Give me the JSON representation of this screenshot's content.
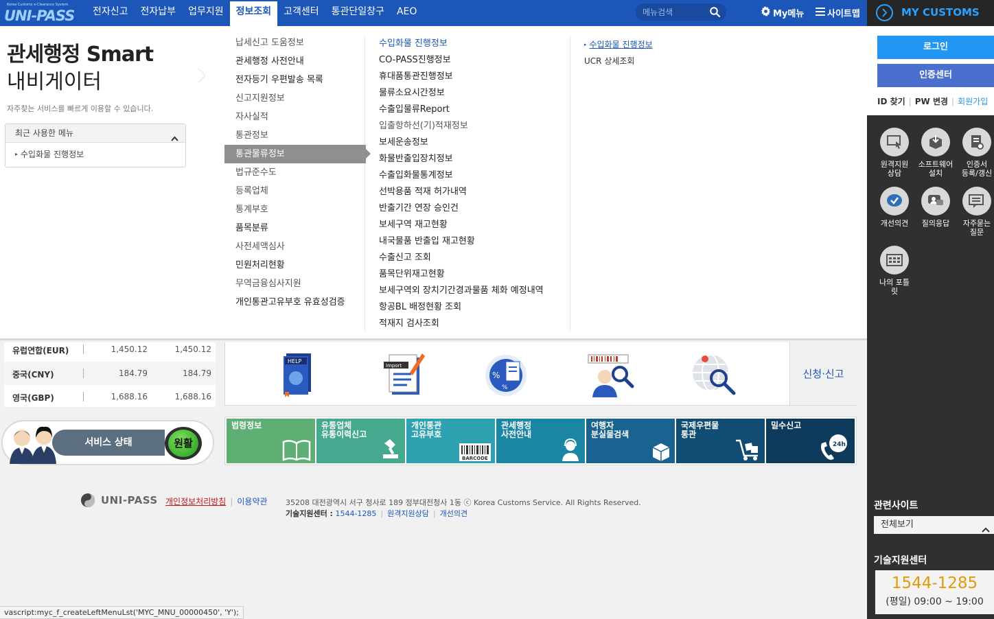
{
  "brand": {
    "tiny": "Korea Customs e-Clearance System",
    "name": "UNI-PASS"
  },
  "nav": {
    "items": [
      "전자신고",
      "전자납부",
      "업무지원",
      "정보조회",
      "고객센터",
      "통관단일창구",
      "AEO"
    ],
    "active": "정보조회"
  },
  "search": {
    "placeholder": "메뉴검색",
    "icon": "search-icon"
  },
  "top_links": {
    "my_menu": "My메뉴",
    "sitemap": "사이트맵"
  },
  "mega": {
    "title_line1": "관세행정 Smart",
    "title_line2": "내비게이터",
    "description": "자주찾는 서비스를 빠르게 이용할 수 있습니다.",
    "recent": {
      "header": "최근 사용한 메뉴",
      "items": [
        "수입화물 진행정보"
      ]
    },
    "col1": [
      "납세신고 도움정보",
      "관세행정 사전안내",
      "전자등기 우편발송 목록",
      "신고지원정보",
      "자사실적",
      "통관정보",
      "통관물류정보",
      "법규준수도",
      "등록업체",
      "통계부호",
      "품목분류",
      "사전세액심사",
      "민원처리현황",
      "무역금융심사지원",
      "개인통관고유부호 유효성검증"
    ],
    "col1_selected": "통관물류정보",
    "col2": [
      "수입화물 진행정보",
      "CO-PASS진행정보",
      "휴대품통관진행정보",
      "물류소요시간정보",
      "수출입물류Report",
      "입출항하선(기)적재정보",
      "보세운송정보",
      "화물반출입장치정보",
      "수출입화물통계정보",
      "선박용품 적재 허가내역",
      "반출기간 연장 승인건",
      "보세구역 재고현황",
      "내국물품 반출입 재고현황",
      "수출신고 조회",
      "품목단위재고현황",
      "보세구역외 장치기간경과물품 체화 예정내역",
      "항공BL 배정현황 조회",
      "적재지 검사조회"
    ],
    "col3": [
      "수입화물 진행정보",
      "UCR 상세조회"
    ]
  },
  "exchange": [
    {
      "currency": "유럽연합(EUR)",
      "buy": "1,450.12",
      "sell": "1,450.12"
    },
    {
      "currency": "중국(CNY)",
      "buy": "184.79",
      "sell": "184.79"
    },
    {
      "currency": "영국(GBP)",
      "buy": "1,688.16",
      "sell": "1,688.16"
    }
  ],
  "service": {
    "label": "서비스 상태",
    "status": "원활"
  },
  "icon_panel": {
    "icons": [
      "help-book-icon",
      "import-document-icon",
      "percent-document-icon",
      "barcode-search-icon",
      "globe-search-icon"
    ],
    "apply_label": "신청·신고"
  },
  "tiles": [
    {
      "label": "법령정보",
      "color": "#5fae74",
      "icon": "book-icon"
    },
    {
      "label": "유통업체\n유통이력신고",
      "color": "#45a98f",
      "icon": "stamp-icon"
    },
    {
      "label": "개인통관\n고유부호",
      "color": "#2ea2b0",
      "icon": "barcode-icon",
      "sub": "BARCODE"
    },
    {
      "label": "관세행정\n사전안내",
      "color": "#1b86a3",
      "icon": "agent-icon"
    },
    {
      "label": "여행자\n분실물검색",
      "color": "#1a6390",
      "icon": "box-icon"
    },
    {
      "label": "국제우편물\n통관",
      "color": "#114c72",
      "icon": "cart-icon"
    },
    {
      "label": "밀수신고",
      "color": "#0e3b5c",
      "icon": "phone-24h-icon",
      "sub": "24h"
    }
  ],
  "footer": {
    "logo_name": "UNI-PASS",
    "privacy": "개인정보처리방침",
    "terms": "이용약관",
    "address": "35208 대전광역시 서구 청사로 189 정부대전청사 1동 ⓒ Korea Customs Service. All Rights Reserved.",
    "tech_label": "기술지원센터 :",
    "tech_phone": "1544-1285",
    "remote": "원격지원상담",
    "opinion": "개선의견"
  },
  "statusbar": "vascript:myc_f_createLeftMenuLst('MYC_MNU_00000450', 'Y');",
  "sidebar": {
    "title": "MY CUSTOMS",
    "login": "로그인",
    "cert": "인증센터",
    "find_id": "ID 찾기",
    "pw_change": "PW 변경",
    "join": "회원가입",
    "icons": [
      {
        "label": "원격지원\n상담",
        "icon": "remote-support-icon"
      },
      {
        "label": "소프트웨어\n설치",
        "icon": "software-install-icon"
      },
      {
        "label": "인증서\n등록/갱신",
        "icon": "certificate-icon"
      },
      {
        "label": "개선의견",
        "icon": "feedback-icon"
      },
      {
        "label": "질의응답",
        "icon": "qna-icon"
      },
      {
        "label": "자주묻는\n질문",
        "icon": "faq-icon"
      },
      {
        "label": "나의 포틀\n릿",
        "icon": "portlet-icon"
      }
    ],
    "related_title": "관련사이트",
    "related_select": "전체보기",
    "tech_title": "기술지원센터",
    "tech_phone": "1544-1285",
    "tech_hours": "(평일) 09:00 ~ 19:00"
  }
}
